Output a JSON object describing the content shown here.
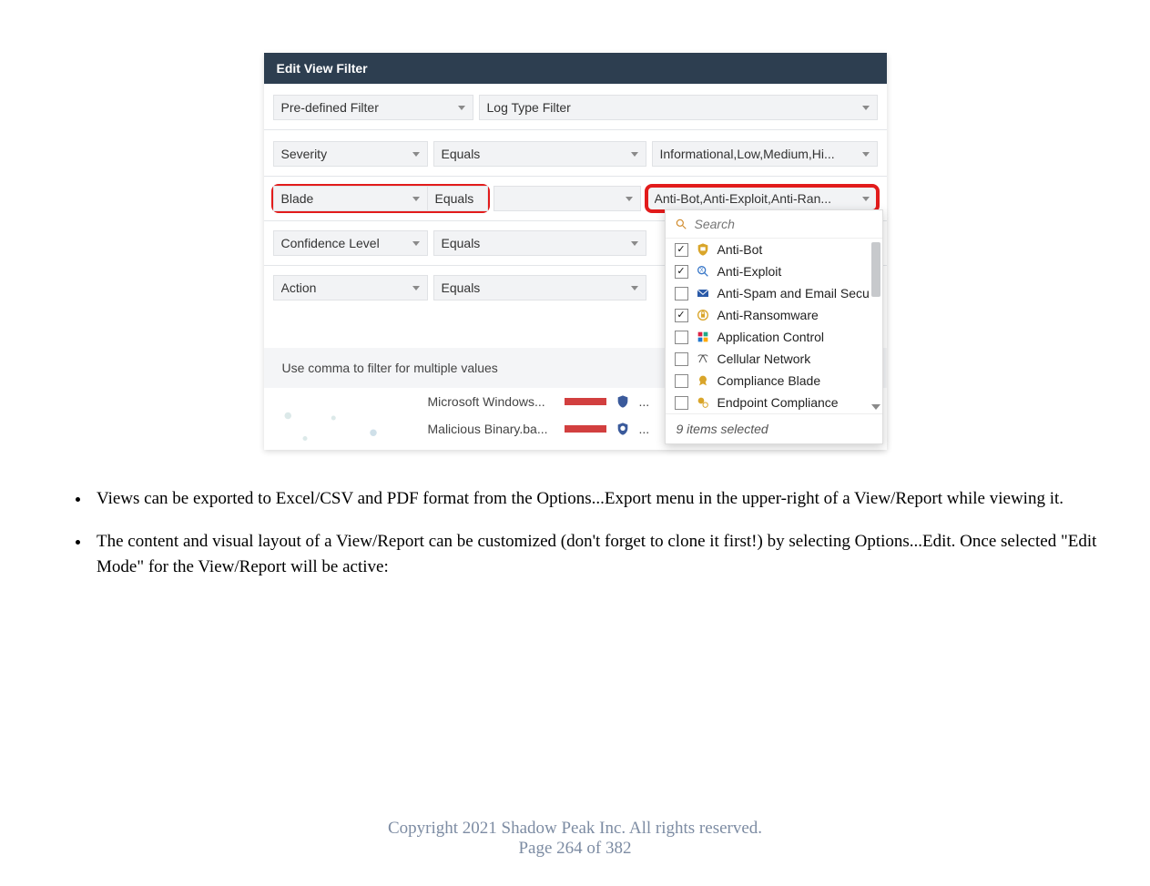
{
  "dialog": {
    "title": "Edit View Filter",
    "predefined_filter": "Pre-defined Filter",
    "log_type_filter": "Log Type Filter",
    "rows": {
      "severity": {
        "field": "Severity",
        "op": "Equals",
        "value": "Informational,Low,Medium,Hi..."
      },
      "blade": {
        "field": "Blade",
        "op": "Equals",
        "value": "Anti-Bot,Anti-Exploit,Anti-Ran..."
      },
      "confidence": {
        "field": "Confidence Level",
        "op": "Equals"
      },
      "action": {
        "field": "Action",
        "op": "Equals"
      }
    },
    "hint": "Use comma to filter for multiple values",
    "bg_items": [
      {
        "label": "Microsoft Windows...",
        "shield_color": "#3a5a9b"
      },
      {
        "label": "Malicious Binary.ba...",
        "shield_color": "#3a5a9b"
      }
    ]
  },
  "dropdown": {
    "search_placeholder": "Search",
    "items": [
      {
        "label": "Anti-Bot",
        "checked": true,
        "icon": "bot"
      },
      {
        "label": "Anti-Exploit",
        "checked": true,
        "icon": "exploit"
      },
      {
        "label": "Anti-Spam and Email Secu",
        "checked": false,
        "icon": "mail"
      },
      {
        "label": "Anti-Ransomware",
        "checked": true,
        "icon": "ransom"
      },
      {
        "label": "Application Control",
        "checked": false,
        "icon": "app"
      },
      {
        "label": "Cellular Network",
        "checked": false,
        "icon": "cell"
      },
      {
        "label": "Compliance Blade",
        "checked": false,
        "icon": "badge"
      },
      {
        "label": "Endpoint Compliance",
        "checked": false,
        "icon": "endpoint"
      }
    ],
    "footer": "9 items selected"
  },
  "bullets": [
    "Views can be exported to Excel/CSV and PDF format from the Options...Export menu in the upper-right of a View/Report while viewing it.",
    "The content and visual layout of a View/Report can be customized (don't forget to clone it first!) by selecting Options...Edit. Once selected \"Edit Mode\" for the View/Report will be active:"
  ],
  "footer": {
    "copyright": "Copyright 2021 Shadow Peak Inc.  All rights reserved.",
    "page": "Page 264 of 382"
  },
  "colors": {
    "header": "#2d3e50",
    "highlight": "#e21b1b"
  }
}
